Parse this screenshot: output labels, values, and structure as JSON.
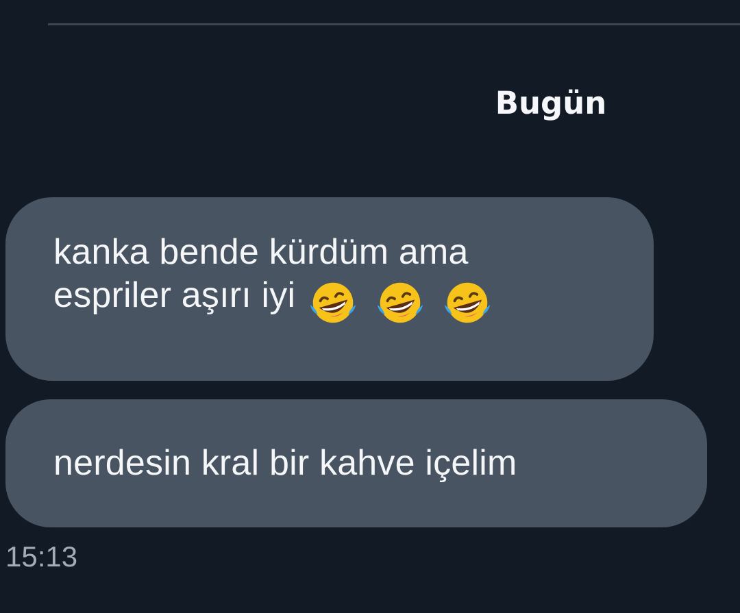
{
  "conversation": {
    "date_separator": "Bugün",
    "messages": [
      {
        "lines": [
          "kanka bende kürdüm ama",
          "espriler aşırı iyi"
        ],
        "emojis": [
          "tears-of-joy-emoji",
          "tears-of-joy-emoji",
          "tears-of-joy-emoji"
        ]
      },
      {
        "lines": [
          "nerdesin kral bir kahve içelim"
        ]
      }
    ],
    "timestamp": "15:13"
  },
  "colors": {
    "background": "#111a25",
    "bubble": "#485462",
    "divider": "#3d4652",
    "timestamp": "#a4adb7",
    "emoji_face": "#f7c21a"
  }
}
